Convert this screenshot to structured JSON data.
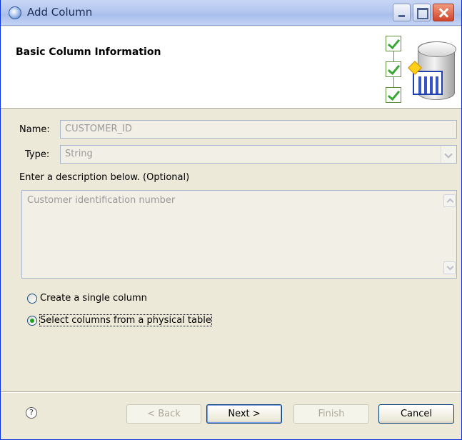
{
  "window": {
    "title": "Add Column"
  },
  "banner": {
    "title": "Basic Column Information"
  },
  "form": {
    "name_label": "Name:",
    "name_value": "CUSTOMER_ID",
    "type_label": "Type:",
    "type_value": "String",
    "description_label": "Enter a description below. (Optional)",
    "description_value": "Customer identification number"
  },
  "options": [
    {
      "label": "Create a single column",
      "selected": false
    },
    {
      "label": "Select columns from a physical table",
      "selected": true
    }
  ],
  "footer": {
    "help": "?",
    "back": "< Back",
    "next": "Next >",
    "finish": "Finish",
    "cancel": "Cancel"
  }
}
